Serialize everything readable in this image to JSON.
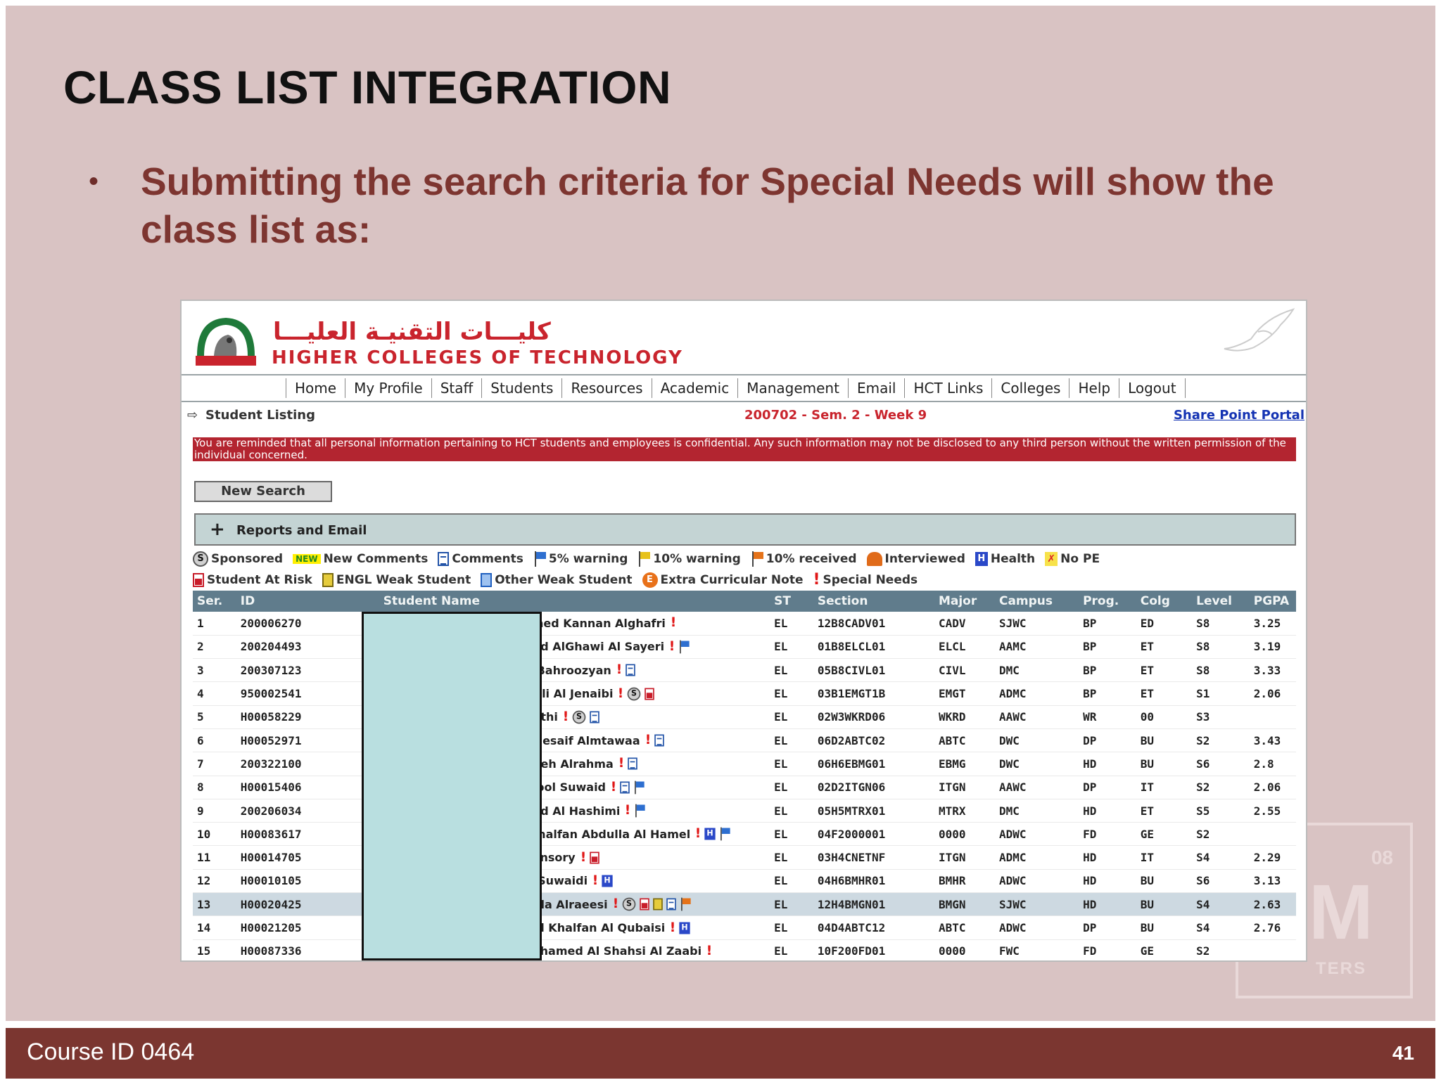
{
  "slide": {
    "title": "CLASS LIST INTEGRATION",
    "bullet_symbol": "•",
    "bullet": "Submitting the search criteria for Special Needs will show the class list as:",
    "footer_left": "Course ID 0464",
    "page_number": "41",
    "watermark_m": "M",
    "watermark_08": "08",
    "watermark_text": "TERS"
  },
  "app": {
    "arabic_name": "كليـــات التقنيـة العليـــا",
    "english_name": "HIGHER COLLEGES OF TECHNOLOGY",
    "nav": [
      "Home",
      "My Profile",
      "Staff",
      "Students",
      "Resources",
      "Academic",
      "Management",
      "Email",
      "HCT Links",
      "Colleges",
      "Help",
      "Logout"
    ],
    "arrow": "⇨",
    "page_label": "Student Listing",
    "term": "200702 - Sem. 2 - Week 9",
    "share_point": "Share Point Portal",
    "notice": "You are reminded that all personal information pertaining to HCT students and employees is confidential. Any such information may not be disclosed to any third person without the written permission of the individual concerned.",
    "new_search": "New Search",
    "reports_plus": "+",
    "reports": "Reports and Email"
  },
  "legend": {
    "row1": [
      {
        "icon": "sponsored-icon",
        "label": "Sponsored"
      },
      {
        "icon": "new-badge",
        "badge": "NEW",
        "label": "New Comments"
      },
      {
        "icon": "comments-icon",
        "label": "Comments"
      },
      {
        "icon": "blue-flag-icon",
        "label": "5% warning"
      },
      {
        "icon": "yellow-flag-icon",
        "label": "10% warning"
      },
      {
        "icon": "orange-flag-icon",
        "label": "10% received"
      },
      {
        "icon": "interviewed-icon",
        "label": "Interviewed"
      },
      {
        "icon": "health-icon",
        "label": "Health"
      },
      {
        "icon": "no-pe-icon",
        "label": "No PE"
      }
    ],
    "row2": [
      {
        "icon": "student-at-risk-icon",
        "label": "Student At Risk"
      },
      {
        "icon": "engl-weak-icon",
        "label": "ENGL Weak Student"
      },
      {
        "icon": "other-weak-icon",
        "label": "Other Weak Student"
      },
      {
        "icon": "extra-curricular-icon",
        "label": "Extra Curricular Note"
      },
      {
        "icon": "special-needs-icon",
        "label": "Special Needs"
      }
    ]
  },
  "table": {
    "headers": [
      "Ser.",
      "ID",
      "Student Name",
      "ST",
      "Section",
      "Major",
      "Campus",
      "Prog.",
      "Colg",
      "Level",
      "PGPA"
    ],
    "rows": [
      {
        "ser": "1",
        "id": "200006270",
        "name": "ashed Kannan Alghafri",
        "flags": [
          "ex"
        ],
        "st": "EL",
        "section": "12B8CADV01",
        "major": "CADV",
        "campus": "SJWC",
        "prog": "BP",
        "colg": "ED",
        "level": "S8",
        "pgpa": "3.25"
      },
      {
        "ser": "2",
        "id": "200204493",
        "name": "mad AlGhawi Al Sayeri",
        "flags": [
          "ex",
          "blueflag"
        ],
        "st": "EL",
        "section": "01B8ELCL01",
        "major": "ELCL",
        "campus": "AAMC",
        "prog": "BP",
        "colg": "ET",
        "level": "S8",
        "pgpa": "3.19"
      },
      {
        "ser": "3",
        "id": "200307123",
        "name": "la Bahroozyan",
        "flags": [
          "ex",
          "doc"
        ],
        "st": "EL",
        "section": "05B8CIVL01",
        "major": "CIVL",
        "campus": "DMC",
        "prog": "BP",
        "colg": "ET",
        "level": "S8",
        "pgpa": "3.33"
      },
      {
        "ser": "4",
        "id": "950002541",
        "name": "n Ali Al Jenaibi",
        "flags": [
          "ex",
          "s",
          "risk"
        ],
        "st": "EL",
        "section": "03B1EMGT1B",
        "major": "EMGT",
        "campus": "ADMC",
        "prog": "BP",
        "colg": "ET",
        "level": "S1",
        "pgpa": "2.06"
      },
      {
        "ser": "5",
        "id": "H00058229",
        "name": "haithi",
        "flags": [
          "ex",
          "s",
          "doc"
        ],
        "st": "EL",
        "section": "02W3WKRD06",
        "major": "WKRD",
        "campus": "AAWC",
        "prog": "WR",
        "colg": "00",
        "level": "S3",
        "pgpa": ""
      },
      {
        "ser": "6",
        "id": "H00052971",
        "name": "n Nesaif Almtawaa",
        "flags": [
          "ex",
          "doc"
        ],
        "st": "EL",
        "section": "06D2ABTC02",
        "major": "ABTC",
        "campus": "DWC",
        "prog": "DP",
        "colg": "BU",
        "level": "S2",
        "pgpa": "3.43"
      },
      {
        "ser": "7",
        "id": "200322100",
        "name": "Saleh Alrahma",
        "flags": [
          "ex",
          "doc"
        ],
        "st": "EL",
        "section": "06H6EBMG01",
        "major": "EBMG",
        "campus": "DWC",
        "prog": "HD",
        "colg": "BU",
        "level": "S6",
        "pgpa": "2.8"
      },
      {
        "ser": "8",
        "id": "H00015406",
        "name": "hyool Suwaid",
        "flags": [
          "ex",
          "doc",
          "blueflag"
        ],
        "st": "EL",
        "section": "02D2ITGN06",
        "major": "ITGN",
        "campus": "AAWC",
        "prog": "DP",
        "colg": "IT",
        "level": "S2",
        "pgpa": "2.06"
      },
      {
        "ser": "9",
        "id": "200206034",
        "name": "mad Al Hashimi",
        "flags": [
          "ex",
          "blueflag"
        ],
        "st": "EL",
        "section": "05H5MTRX01",
        "major": "MTRX",
        "campus": "DMC",
        "prog": "HD",
        "colg": "ET",
        "level": "S5",
        "pgpa": "2.55"
      },
      {
        "ser": "10",
        "id": "H00083617",
        "name": "l Khalfan Abdulla Al Hamel",
        "flags": [
          "ex",
          "h",
          "blueflag"
        ],
        "st": "EL",
        "section": "04F2000001",
        "major": "0000",
        "campus": "ADWC",
        "prog": "FD",
        "colg": "GE",
        "level": "S2",
        "pgpa": ""
      },
      {
        "ser": "11",
        "id": "H00014705",
        "name": "Mansory",
        "flags": [
          "ex",
          "risk"
        ],
        "st": "EL",
        "section": "03H4CNETNF",
        "major": "ITGN",
        "campus": "ADMC",
        "prog": "HD",
        "colg": "IT",
        "level": "S4",
        "pgpa": "2.29"
      },
      {
        "ser": "12",
        "id": "H00010105",
        "name": "Al Suwaidi",
        "flags": [
          "ex",
          "h"
        ],
        "st": "EL",
        "section": "04H6BMHR01",
        "major": "BMHR",
        "campus": "ADWC",
        "prog": "HD",
        "colg": "BU",
        "level": "S6",
        "pgpa": "3.13"
      },
      {
        "ser": "13",
        "id": "H00020425",
        "name": "dalla Alraeesi",
        "flags": [
          "ex",
          "s",
          "risk",
          "engl",
          "doc",
          "orangeflag"
        ],
        "st": "EL",
        "section": "12H4BMGN01",
        "major": "BMGN",
        "campus": "SJWC",
        "prog": "HD",
        "colg": "BU",
        "level": "S4",
        "pgpa": "2.63",
        "highlight": true
      },
      {
        "ser": "14",
        "id": "H00021205",
        "name": "mel Khalfan Al Qubaisi",
        "flags": [
          "ex",
          "h"
        ],
        "st": "EL",
        "section": "04D4ABTC12",
        "major": "ABTC",
        "campus": "ADWC",
        "prog": "DP",
        "colg": "BU",
        "level": "S4",
        "pgpa": "2.76"
      },
      {
        "ser": "15",
        "id": "H00087336",
        "name": "Mohamed Al Shahsi Al Zaabi",
        "flags": [
          "ex"
        ],
        "st": "EL",
        "section": "10F200FD01",
        "major": "0000",
        "campus": "FWC",
        "prog": "FD",
        "colg": "GE",
        "level": "S2",
        "pgpa": ""
      }
    ]
  },
  "colors": {
    "slide_bg": "#d9c3c3",
    "bullet_text": "#7d3530",
    "footer_bg": "#7b3630",
    "hct_red": "#c9242d",
    "table_header": "#607c8c",
    "redaction": "#b9dfe0"
  }
}
